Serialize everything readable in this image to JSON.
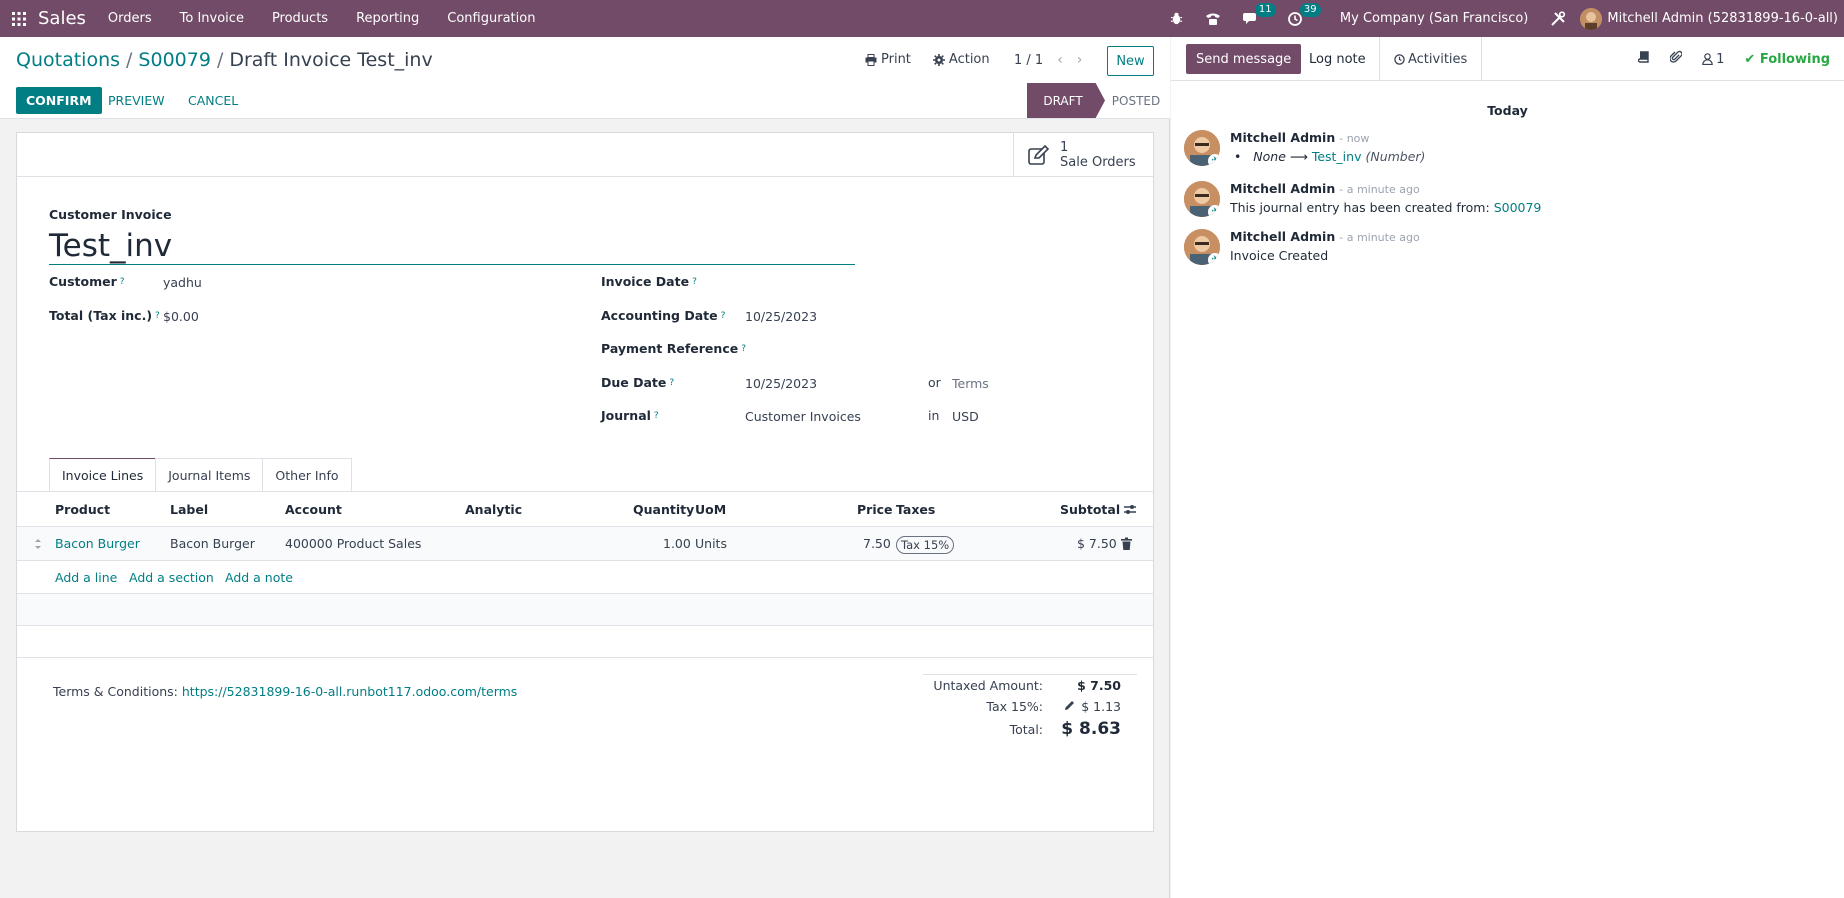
{
  "navbar": {
    "app_name": "Sales",
    "menu": [
      "Orders",
      "To Invoice",
      "Products",
      "Reporting",
      "Configuration"
    ],
    "messages_count": "11",
    "activities_count": "39",
    "company": "My Company (San Francisco)",
    "user": "Mitchell Admin (52831899-16-0-all)"
  },
  "control_panel": {
    "breadcrumb": [
      "Quotations",
      "S00079",
      "Draft Invoice Test_inv"
    ],
    "print_label": "Print",
    "action_label": "Action",
    "pager": "1 / 1",
    "new_label": "New",
    "confirm_label": "CONFIRM",
    "preview_label": "PREVIEW",
    "cancel_label": "CANCEL",
    "stages": [
      "DRAFT",
      "POSTED"
    ]
  },
  "smart_button": {
    "count": "1",
    "label": "Sale Orders"
  },
  "form": {
    "type_label": "Customer Invoice",
    "name": "Test_inv",
    "customer_label": "Customer",
    "customer_value": "yadhu",
    "total_label": "Total (Tax inc.)",
    "total_value": "$0.00",
    "invoice_date_label": "Invoice Date",
    "accounting_date_label": "Accounting Date",
    "accounting_date_value": "10/25/2023",
    "payment_ref_label": "Payment Reference",
    "due_date_label": "Due Date",
    "due_date_value": "10/25/2023",
    "or_label": "or",
    "terms_value": "Terms",
    "journal_label": "Journal",
    "journal_value": "Customer Invoices",
    "in_label": "in",
    "currency_value": "USD"
  },
  "tabs": [
    "Invoice Lines",
    "Journal Items",
    "Other Info"
  ],
  "table": {
    "headers": [
      "Product",
      "Label",
      "Account",
      "Analytic",
      "Quantity",
      "UoM",
      "Price",
      "Taxes",
      "Subtotal"
    ],
    "rows": [
      {
        "product": "Bacon Burger",
        "label": "Bacon Burger",
        "account": "400000 Product Sales",
        "analytic": "",
        "quantity": "1.00",
        "uom": "Units",
        "price": "7.50",
        "taxes": "Tax 15%",
        "subtotal": "$ 7.50"
      }
    ],
    "add_line": "Add a line",
    "add_section": "Add a section",
    "add_note": "Add a note"
  },
  "footer": {
    "terms_label": "Terms & Conditions:",
    "terms_url": "https://52831899-16-0-all.runbot117.odoo.com/terms",
    "untaxed_label": "Untaxed Amount:",
    "untaxed_value": "$ 7.50",
    "tax_label": "Tax 15%:",
    "tax_value": "$ 1.13",
    "total_label": "Total:",
    "total_value": "$ 8.63"
  },
  "chatter": {
    "send_label": "Send message",
    "log_label": "Log note",
    "activities_label": "Activities",
    "followers_count": "1",
    "following_label": "Following",
    "date_separator": "Today",
    "messages": [
      {
        "author": "Mitchell Admin",
        "time": "- now",
        "old": "None",
        "new": "Test_inv",
        "field": "(Number)"
      },
      {
        "author": "Mitchell Admin",
        "time": "- a minute ago",
        "body": "This journal entry has been created from:",
        "link": "S00079"
      },
      {
        "author": "Mitchell Admin",
        "time": "- a minute ago",
        "body": "Invoice Created"
      }
    ]
  }
}
